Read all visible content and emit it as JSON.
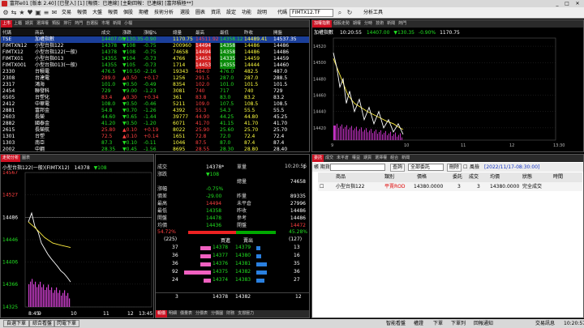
{
  "window": {
    "title": "富邦e01 [版本 2.40] [已登入] [1] [報價：已連線] [主動回報：已連線] [富邦積極**]",
    "min": "_",
    "max": "□",
    "close": "✕"
  },
  "menu": {
    "items": [
      "交易",
      "報價",
      "大盤",
      "報價",
      "個股",
      "期權",
      "技術分析",
      "選股",
      "圖表",
      "資訊",
      "設定",
      "功能",
      "說明"
    ],
    "code_label": "代碼",
    "code_value": "FIMTX12.TF",
    "analysis": "分析工具"
  },
  "quote_panel": {
    "tabs": [
      "上市",
      "上櫃",
      "期貨",
      "選擇權",
      "類股",
      "排行",
      "熱門",
      "自選股",
      "市場",
      "新聞",
      "小檔"
    ],
    "headers": [
      "代碼",
      "商品",
      "成交",
      "漲跌",
      "漲幅%",
      "總量",
      "最高",
      "最低",
      "昨收",
      "開盤"
    ],
    "rows": [
      {
        "code": "TSE",
        "name": "加權指數",
        "price": "14407.00",
        "chg": "▼130.35",
        "pct": "-0.90",
        "vol": "1170.75",
        "high": "14511.92",
        "low": "14358.12",
        "prev": "14489.41",
        "open": "14537.35",
        "hl": true
      },
      {
        "code": "FIMTXN12",
        "name": "小型台指122",
        "price": "14378",
        "chg": "▼108",
        "pct": "-0.75",
        "vol": "200960",
        "high": "14494",
        "low": "14358",
        "prev": "14486",
        "open": "14486"
      },
      {
        "code": "FIMTX12",
        "name": "小型台指122(一般)",
        "price": "14378",
        "chg": "▼108",
        "pct": "-0.75",
        "vol": "74658",
        "high": "14494",
        "low": "14358",
        "prev": "14486",
        "open": "14486"
      },
      {
        "code": "FIMTX01",
        "name": "小型台指013",
        "price": "14355",
        "chg": "▼104",
        "pct": "-0.73",
        "vol": "4766",
        "high": "14453",
        "low": "14335",
        "prev": "14459",
        "open": "14459"
      },
      {
        "code": "FIMTX001",
        "name": "小型台指013(一般)",
        "price": "14355",
        "chg": "▼105",
        "pct": "-0.73",
        "vol": "1714",
        "high": "14453",
        "low": "14355",
        "prev": "14444",
        "open": "14460"
      },
      {
        "code": "2330",
        "name": "台積電",
        "price": "476.5",
        "chg": "▼10.50",
        "pct": "-2.16",
        "vol": "19343",
        "high": "484.0",
        "low": "476.0",
        "prev": "482.5",
        "open": "487.0"
      },
      {
        "code": "2308",
        "name": "台達電",
        "price": "289.0",
        "chg": "▲0.50",
        "pct": "+0.17",
        "vol": "1256",
        "high": "291.5",
        "low": "287.0",
        "prev": "287.0",
        "open": "288.5"
      },
      {
        "code": "2317",
        "name": "鴻海",
        "price": "101.0",
        "chg": "▼0.50",
        "pct": "-0.49",
        "vol": "8354",
        "high": "102.0",
        "low": "101.0",
        "prev": "101.5",
        "open": "101.5"
      },
      {
        "code": "2454",
        "name": "聯發科",
        "price": "729",
        "chg": "▼9.00",
        "pct": "-1.23",
        "vol": "3081",
        "high": "740",
        "low": "717",
        "prev": "740",
        "open": "729"
      },
      {
        "code": "6505",
        "name": "台塑化",
        "price": "83.4",
        "chg": "▲0.30",
        "pct": "+0.34",
        "vol": "361",
        "high": "83.8",
        "low": "83.0",
        "prev": "83.2",
        "open": "83.2"
      },
      {
        "code": "2412",
        "name": "中華電",
        "price": "108.0",
        "chg": "▼0.50",
        "pct": "-0.46",
        "vol": "5211",
        "high": "109.0",
        "low": "107.5",
        "prev": "108.5",
        "open": "108.5"
      },
      {
        "code": "2881",
        "name": "富邦金",
        "price": "54.8",
        "chg": "▼0.70",
        "pct": "-1.26",
        "vol": "4392",
        "high": "55.3",
        "low": "54.3",
        "prev": "55.5",
        "open": "55.5"
      },
      {
        "code": "2603",
        "name": "長榮",
        "price": "44.60",
        "chg": "▼0.65",
        "pct": "-1.44",
        "vol": "39777",
        "high": "44.90",
        "low": "44.25",
        "prev": "44.80",
        "open": "45.25"
      },
      {
        "code": "2882",
        "name": "國泰金",
        "price": "41.20",
        "chg": "▼0.50",
        "pct": "-1.20",
        "vol": "6071",
        "high": "41.70",
        "low": "41.15",
        "prev": "41.70",
        "open": "41.70"
      },
      {
        "code": "2615",
        "name": "長榮航",
        "price": "25.80",
        "chg": "▲0.10",
        "pct": "+0.19",
        "vol": "8022",
        "high": "25.90",
        "low": "25.60",
        "prev": "25.70",
        "open": "25.70"
      },
      {
        "code": "1301",
        "name": "台塑",
        "price": "72.5",
        "chg": "▲0.10",
        "pct": "+0.14",
        "vol": "1651",
        "high": "72.8",
        "low": "72.0",
        "prev": "72.4",
        "open": "72.4"
      },
      {
        "code": "1303",
        "name": "南亞",
        "price": "87.3",
        "chg": "▼0.10",
        "pct": "-0.11",
        "vol": "1046",
        "high": "87.5",
        "low": "87.0",
        "prev": "87.4",
        "open": "87.4"
      },
      {
        "code": "2002",
        "name": "中鋼",
        "price": "28.35",
        "chg": "▼0.45",
        "pct": "-1.56",
        "vol": "8695",
        "high": "28.55",
        "low": "28.30",
        "prev": "28.80",
        "open": "28.40"
      }
    ]
  },
  "index_chart": {
    "tabs": [
      "加權指數",
      "個股走勢",
      "期權",
      "分時",
      "技術",
      "新聞",
      "熱門"
    ],
    "title": "加權指數",
    "time": "10:20:55",
    "price": "14407.00",
    "chg": "▼130.35",
    "pct": "-0.90%",
    "vol": "1170.75",
    "y_ticks": [
      "14520",
      "14500",
      "14480",
      "14460",
      "14440",
      "14420"
    ],
    "x_ticks": [
      "9",
      "10",
      "11",
      "12",
      "13:30"
    ]
  },
  "tick_panel": {
    "tabs": [
      "走勢分析",
      "圖表"
    ],
    "title": "小型台指122(一般)(FIMTX12)",
    "price": "14378",
    "chg": "▼108",
    "time": "10:20:56",
    "y_ticks": [
      "14567",
      "14527",
      "14486",
      "14446",
      "14406",
      "14366",
      "14325"
    ],
    "x_ticks": [
      "8:45",
      "9",
      "10",
      "11",
      "12",
      "13:45"
    ],
    "info": [
      {
        "l": "成交",
        "v": "14378*",
        "l2": "單量",
        "v2": "1"
      },
      {
        "l": "漲跌",
        "v": "▼108",
        "l2": "",
        "v2": ""
      },
      {
        "l": "",
        "v": "",
        "l2": "總量",
        "v2": "74658"
      },
      {
        "l": "漲幅",
        "v": "-0.75%",
        "l2": "",
        "v2": ""
      },
      {
        "l": "價差",
        "v": "-29.00",
        "l2": "昨量",
        "v2": "89335"
      },
      {
        "l": "最高",
        "v": "14494",
        "l2": "未平倉",
        "v2": "27996"
      },
      {
        "l": "最低",
        "v": "14358",
        "l2": "昨收",
        "v2": "14486"
      },
      {
        "l": "開盤",
        "v": "14478",
        "l2": "參考",
        "v2": "14486"
      },
      {
        "l": "均價",
        "v": "14436",
        "l2": "開盤",
        "v2": "14472"
      }
    ],
    "buy_pct": "54.72%",
    "sell_pct": "45.28%",
    "buy_total": "(225)",
    "sell_total": "(127)",
    "col_buy": "買進",
    "col_sell": "賣出",
    "book": [
      {
        "bq": "37",
        "bp": "14378",
        "ap": "14379",
        "aq": "13",
        "bw": 0.37
      },
      {
        "bq": "36",
        "bp": "14377",
        "ap": "14380",
        "aq": "16",
        "bw": 0.36
      },
      {
        "bq": "36",
        "bp": "14376",
        "ap": "14381",
        "aq": "35",
        "bw": 0.36
      },
      {
        "bq": "92",
        "bp": "14375",
        "ap": "14382",
        "aq": "36",
        "bw": 0.92
      },
      {
        "bq": "24",
        "bp": "14374",
        "ap": "14383",
        "aq": "27",
        "bw": 0.24
      }
    ],
    "last": {
      "q": "3",
      "bp": "14378",
      "ap": "14382",
      "aq": "12"
    },
    "bottom_tabs": [
      "報價",
      "明細",
      "價量表",
      "分價表",
      "分價圖",
      "財務",
      "支撐壓力"
    ]
  },
  "order_panel": {
    "tabs": [
      "委託",
      "成交",
      "未平倉",
      "權益",
      "期貨",
      "選擇權",
      "組合",
      "新聞"
    ],
    "account_label": "帳 期貨",
    "query": "查詢",
    "filter": "全部委託",
    "delete": "刪除",
    "risk": "風檢",
    "datetime": "[2022/11/17-08:30:00]",
    "headers": [
      "",
      "商品",
      "類別",
      "價格",
      "委託",
      "成交",
      "均價",
      "狀態",
      "時間"
    ],
    "rows": [
      {
        "name": "小型台指122",
        "type": "平賣ROD",
        "price": "14380.0000",
        "qty": "3",
        "filled": "3",
        "avg": "14380.0000",
        "status": "完全成交",
        "time": ""
      }
    ]
  },
  "status": {
    "left_tabs": [
      "自選下單",
      "綜合看盤",
      "閃電下單"
    ],
    "right_items": [
      "智能看盤",
      "權證",
      "下單",
      "下單列",
      "回報通知",
      "交易訊息"
    ],
    "clock": "10:20:57"
  }
}
